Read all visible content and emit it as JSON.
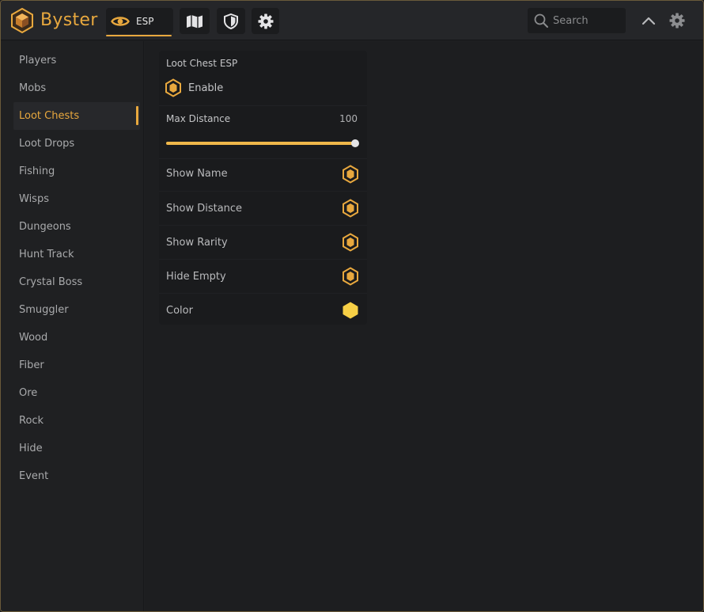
{
  "app": {
    "name": "Byster"
  },
  "topbar": {
    "tabs": [
      {
        "icon": "eye-icon",
        "label": "ESP",
        "active": true
      },
      {
        "icon": "map-icon",
        "label": ""
      },
      {
        "icon": "shield-icon",
        "label": ""
      },
      {
        "icon": "gear-icon",
        "label": ""
      }
    ],
    "search": {
      "placeholder": "Search",
      "value": ""
    }
  },
  "sidebar": {
    "items": [
      {
        "label": "Players"
      },
      {
        "label": "Mobs"
      },
      {
        "label": "Loot Chests",
        "active": true
      },
      {
        "label": "Loot Drops"
      },
      {
        "label": "Fishing"
      },
      {
        "label": "Wisps"
      },
      {
        "label": "Dungeons"
      },
      {
        "label": "Hunt Track"
      },
      {
        "label": "Crystal Boss"
      },
      {
        "label": "Smuggler"
      },
      {
        "label": "Wood"
      },
      {
        "label": "Fiber"
      },
      {
        "label": "Ore"
      },
      {
        "label": "Rock"
      },
      {
        "label": "Hide"
      },
      {
        "label": "Event"
      }
    ]
  },
  "panel": {
    "title": "Loot Chest ESP",
    "enable": {
      "label": "Enable",
      "checked": true
    },
    "max_distance": {
      "label": "Max Distance",
      "value": "100",
      "fraction": 1.0
    },
    "options": [
      {
        "label": "Show Name",
        "icon": "hex-toggle-icon",
        "checked": true
      },
      {
        "label": "Show Distance",
        "icon": "hex-toggle-icon",
        "checked": true
      },
      {
        "label": "Show Rarity",
        "icon": "hex-toggle-icon",
        "checked": true
      },
      {
        "label": "Hide Empty",
        "icon": "hex-toggle-icon",
        "checked": true
      },
      {
        "label": "Color",
        "icon": "color-swatch-icon",
        "color": "#f7d046"
      }
    ]
  },
  "colors": {
    "accent": "#e8a83e",
    "slider_fill": "#f0b84a",
    "swatch": "#f7d046"
  }
}
